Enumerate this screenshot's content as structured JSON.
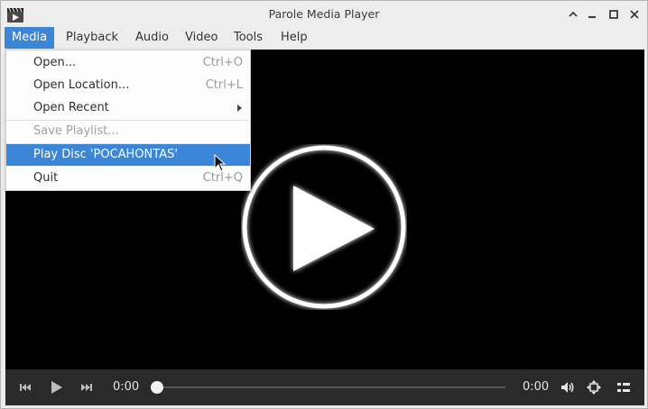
{
  "window": {
    "title": "Parole Media Player",
    "icons": {
      "app": "film-clapper-icon",
      "rollup": "chevron-up-icon",
      "minimize": "minimize-icon",
      "maximize": "maximize-icon",
      "close": "close-icon"
    }
  },
  "menubar": {
    "items": [
      {
        "label": "Media",
        "active": true
      },
      {
        "label": "Playback"
      },
      {
        "label": "Audio"
      },
      {
        "label": "Video"
      },
      {
        "label": "Tools"
      },
      {
        "label": "Help"
      }
    ]
  },
  "media_menu": {
    "items": [
      {
        "label": "Open...",
        "accel": "Ctrl+O"
      },
      {
        "label": "Open Location...",
        "accel": "Ctrl+L"
      },
      {
        "label": "Open Recent",
        "submenu": true
      },
      {
        "label": "Save Playlist...",
        "disabled": true
      },
      {
        "label": "Play Disc 'POCAHONTAS'",
        "selected": true
      },
      {
        "label": "Quit",
        "accel": "Ctrl+Q"
      }
    ]
  },
  "player": {
    "overlay_icon": "play-circle-icon",
    "current_time": "0:00",
    "total_time": "0:00",
    "progress": 0,
    "controls": {
      "previous": "skip-previous-icon",
      "play": "play-icon",
      "next": "skip-next-icon",
      "volume": "volume-icon",
      "fullscreen": "fullscreen-icon",
      "playlist": "playlist-icon"
    }
  },
  "colors": {
    "accent": "#3c86d8",
    "video_bg": "#000000",
    "controls_bg": "#2a2a2a"
  }
}
